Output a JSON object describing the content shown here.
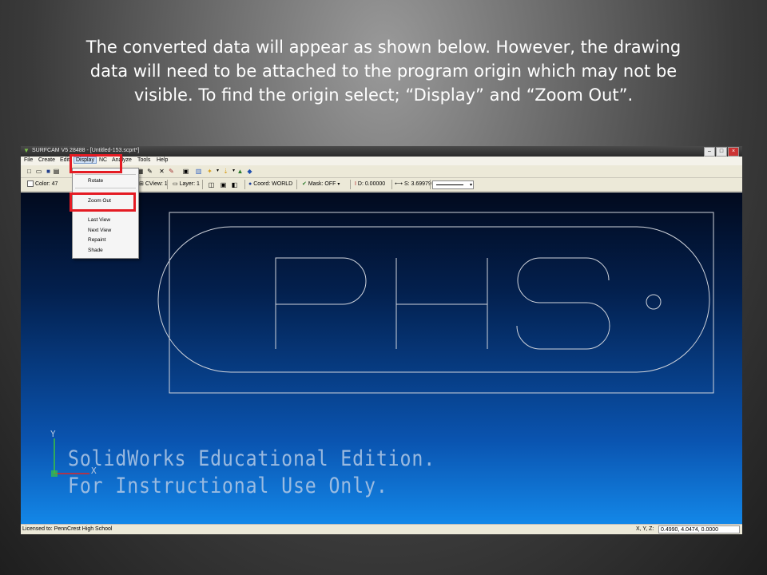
{
  "caption": {
    "line1": "The converted data will appear as shown below. However, the drawing",
    "line2": "data will need to be attached to the program origin which may not be",
    "line3": "visible. To find the origin select; “Display” and “Zoom Out”."
  },
  "window": {
    "title": "SURFCAM V5 28488 - [Untitled-153.scprt*]",
    "minimize_icon": "minimize-icon",
    "maximize_icon": "maximize-icon",
    "close_icon": "close-icon"
  },
  "menubar": {
    "items": [
      "File",
      "Create",
      "Edit",
      "Display",
      "NC",
      "Analyze",
      "Tools",
      "Help"
    ]
  },
  "toolbar2": {
    "color": "Color: 47",
    "cview": "CView: 1",
    "layer": "Layer: 1",
    "coord": "Coord: WORLD",
    "mask": "Mask: OFF",
    "depth": "D: 0.00000",
    "step": "S: 3.69979"
  },
  "display_menu": {
    "items": [
      "Rotate",
      "Zoom Out",
      "Last View",
      "Next View",
      "Repaint",
      "Shade"
    ]
  },
  "watermark": {
    "line1": "SolidWorks Educational Edition.",
    "line2": "For Instructional Use Only."
  },
  "axes": {
    "y": "Y",
    "x": "X"
  },
  "drawing": {
    "text": "PHS"
  },
  "status": {
    "license": "Licensed to: PennCrest High School",
    "xyz_label": "X, Y, Z:",
    "xyz_value": "0.4990, 4.0474, 0.0000"
  },
  "colors": {
    "highlight": "#e41b23",
    "viewport_top": "#020a1e",
    "viewport_bottom": "#1387e8",
    "geometry": "#d0d4dc"
  }
}
